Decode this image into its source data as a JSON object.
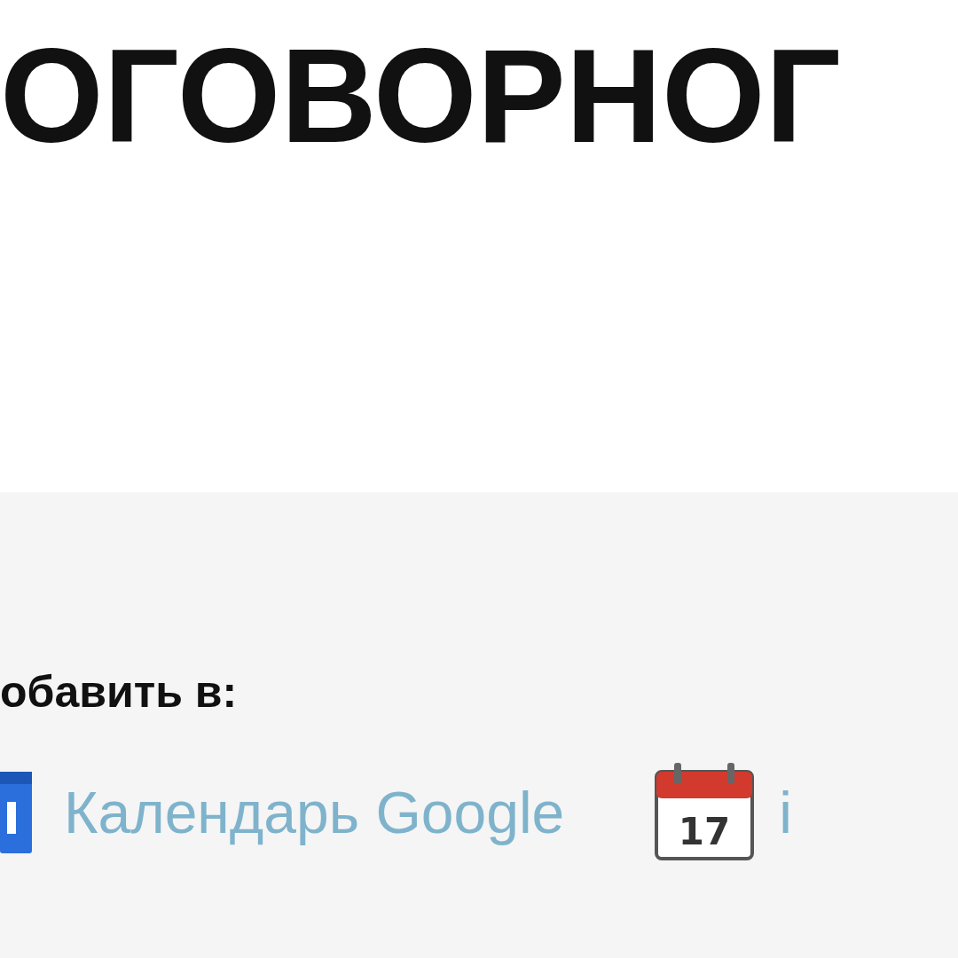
{
  "heading": "ОГОВОРНОГ",
  "add_to": {
    "label": "обавить в:",
    "links": [
      {
        "kind": "google",
        "label": "Календарь Google"
      },
      {
        "kind": "ical",
        "label": "i",
        "day": "17"
      }
    ]
  }
}
